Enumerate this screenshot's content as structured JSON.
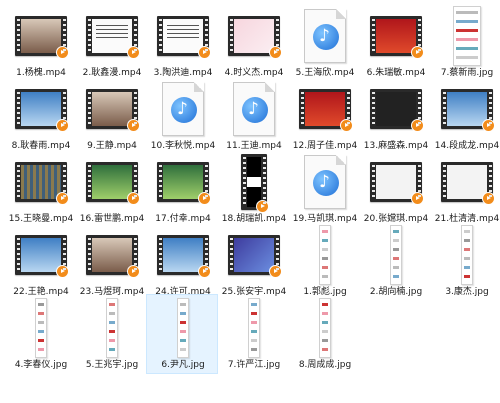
{
  "files": [
    {
      "name": "1.杨槐.mp4",
      "kind": "video",
      "scene": "sc-photo"
    },
    {
      "name": "2.耿鑫漫.mp4",
      "kind": "video",
      "scene": "sc-doc"
    },
    {
      "name": "3.陶洪迪.mp4",
      "kind": "video",
      "scene": "sc-doc"
    },
    {
      "name": "4.时义杰.mp4",
      "kind": "video",
      "scene": "sc-pink"
    },
    {
      "name": "5.王海欣.mp4",
      "kind": "media"
    },
    {
      "name": "6.朱瑞敏.mp4",
      "kind": "video",
      "scene": "sc-red"
    },
    {
      "name": "7.蔡新雨.jpg",
      "kind": "image-wide"
    },
    {
      "name": "8.耿春雨.mp4",
      "kind": "video",
      "scene": "sc-blue"
    },
    {
      "name": "9.王静.mp4",
      "kind": "video",
      "scene": "sc-photo"
    },
    {
      "name": "10.李秋悦.mp4",
      "kind": "media"
    },
    {
      "name": "11.王迪.mp4",
      "kind": "media"
    },
    {
      "name": "12.周子佳.mp4",
      "kind": "video",
      "scene": "sc-red"
    },
    {
      "name": "13.麻盛森.mp4",
      "kind": "video",
      "scene": "sc-dark"
    },
    {
      "name": "14.段成龙.mp4",
      "kind": "video",
      "scene": "sc-blue"
    },
    {
      "name": "15.王晓曼.mp4",
      "kind": "video",
      "scene": "sc-class"
    },
    {
      "name": "16.雷世鹏.mp4",
      "kind": "video",
      "scene": "sc-green"
    },
    {
      "name": "17.付幸.mp4",
      "kind": "video",
      "scene": "sc-green"
    },
    {
      "name": "18.胡瑞凯.mp4",
      "kind": "video-black"
    },
    {
      "name": "19.马凯琪.mp4",
      "kind": "media"
    },
    {
      "name": "20.张嫦琪.mp4",
      "kind": "video",
      "scene": "sc-light"
    },
    {
      "name": "21.杜清清.mp4",
      "kind": "video",
      "scene": "sc-light"
    },
    {
      "name": "22.王艳.mp4",
      "kind": "video",
      "scene": "sc-blue"
    },
    {
      "name": "23.马煜珂.mp4",
      "kind": "video",
      "scene": "sc-photo"
    },
    {
      "name": "24.许可.mp4",
      "kind": "video",
      "scene": "sc-blue"
    },
    {
      "name": "25.张安宇.mp4",
      "kind": "video",
      "scene": "sc-purple"
    },
    {
      "name": "1.郭彪.jpg",
      "kind": "image"
    },
    {
      "name": "2.胡向楠.jpg",
      "kind": "image"
    },
    {
      "name": "3.康杰.jpg",
      "kind": "image"
    },
    {
      "name": "4.李春仪.jpg",
      "kind": "image"
    },
    {
      "name": "5.王兆宇.jpg",
      "kind": "image"
    },
    {
      "name": "6.尹凡.jpg",
      "kind": "image",
      "selected": true
    },
    {
      "name": "7.许严江.jpg",
      "kind": "image"
    },
    {
      "name": "8.周成成.jpg",
      "kind": "image"
    }
  ]
}
